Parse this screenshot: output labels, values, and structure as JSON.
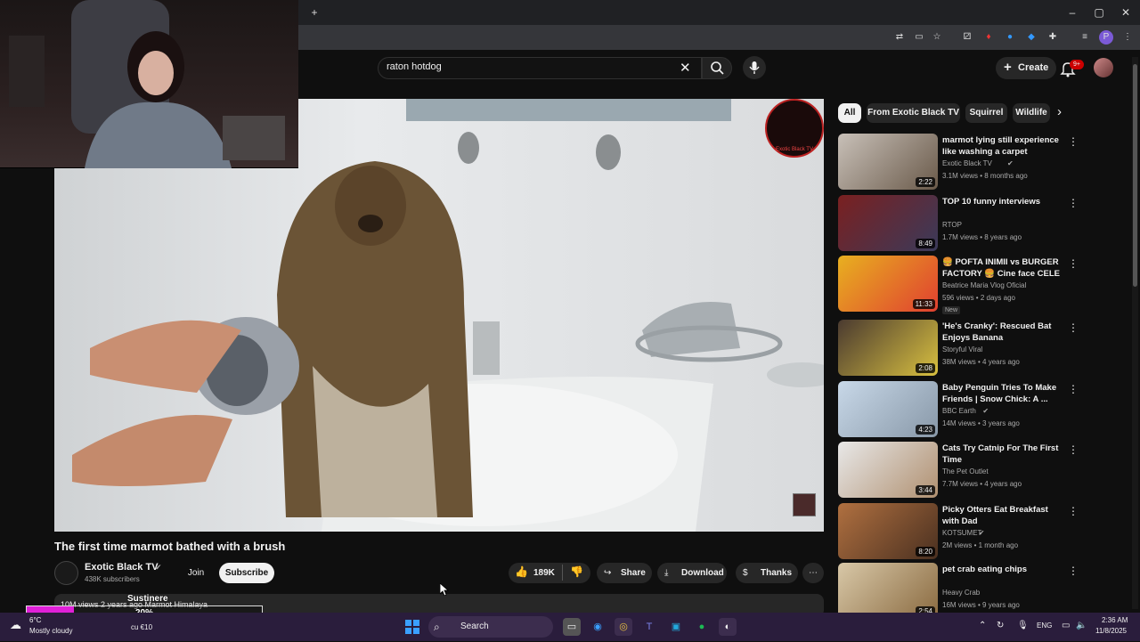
{
  "browser": {
    "new_tab_icon": "plus-icon",
    "win_controls": [
      "minimize-icon",
      "restore-icon",
      "close-icon"
    ]
  },
  "youtube": {
    "search": {
      "value": "raton hotdog"
    },
    "create_label": "Create",
    "notif_count": "9+"
  },
  "video": {
    "title": "The first time marmot bathed with a brush",
    "channel": "Exotic Black TV",
    "subscribers": "438K subscribers",
    "join_label": "Join",
    "subscribe_label": "Subscribe",
    "likes": "189K",
    "share_label": "Share",
    "download_label": "Download",
    "thanks_label": "Thanks",
    "watermark": "Exotic Black TV",
    "desc_line": "10M views  2 years ago  Marmot Himalaya"
  },
  "chips": [
    "All",
    "From Exotic Black TV",
    "Squirrel",
    "Wildlife"
  ],
  "recommendations": [
    {
      "title": "marmot lying still experience like washing a carpet",
      "channel": "Exotic Black TV",
      "verified": true,
      "meta": "3.1M views • 8 months ago",
      "duration": "2:22",
      "color1": "#c8c0b8",
      "color2": "#6a5a4a"
    },
    {
      "title": "TOP 10 funny interviews",
      "channel": "RTOP",
      "verified": false,
      "meta": "1.7M views • 8 years ago",
      "duration": "8:49",
      "color1": "#7a2020",
      "color2": "#3a3a5a"
    },
    {
      "title": "🍔 POFTA INIMII vs BURGER FACTORY 🍔 Cine face CELE ...",
      "channel": "Beatrice Maria Vlog Oficial",
      "verified": false,
      "meta": "596 views • 2 days ago",
      "badge": "New",
      "duration": "11:33",
      "color1": "#e8b020",
      "color2": "#e04030"
    },
    {
      "title": "'He's Cranky': Rescued Bat Enjoys Banana",
      "channel": "Storyful Viral",
      "verified": false,
      "meta": "38M views • 4 years ago",
      "duration": "2:08",
      "color1": "#4a3a30",
      "color2": "#d8c040"
    },
    {
      "title": "Baby Penguin Tries To Make Friends | Snow Chick: A ...",
      "channel": "BBC Earth",
      "verified": true,
      "meta": "14M views • 3 years ago",
      "duration": "4:23",
      "color1": "#c8d8e8",
      "color2": "#8898a8"
    },
    {
      "title": "Cats Try Catnip For The First Time",
      "channel": "The Pet Outlet",
      "verified": false,
      "meta": "7.7M views • 4 years ago",
      "duration": "3:44",
      "color1": "#e8e8e8",
      "color2": "#b09070"
    },
    {
      "title": "Picky Otters Eat Breakfast with Dad",
      "channel": "KOTSUMET",
      "verified": true,
      "meta": "2M views • 1 month ago",
      "duration": "8:20",
      "color1": "#b07040",
      "color2": "#4a3020"
    },
    {
      "title": "pet crab eating chips",
      "channel": "Heavy Crab",
      "verified": false,
      "meta": "16M views • 9 years ago",
      "duration": "2:54",
      "color1": "#d8c8a8",
      "color2": "#8a6a40"
    }
  ],
  "overlay": {
    "label": "Sustinere",
    "percent_text": "20%",
    "percent": 20
  },
  "taskbar": {
    "weather_temp": "6°C",
    "weather_desc": "Mostly cloudy",
    "money": "cu €10",
    "search_label": "Search",
    "lang": "ENG",
    "time": "2:36 AM",
    "date": "11/8/2025"
  }
}
